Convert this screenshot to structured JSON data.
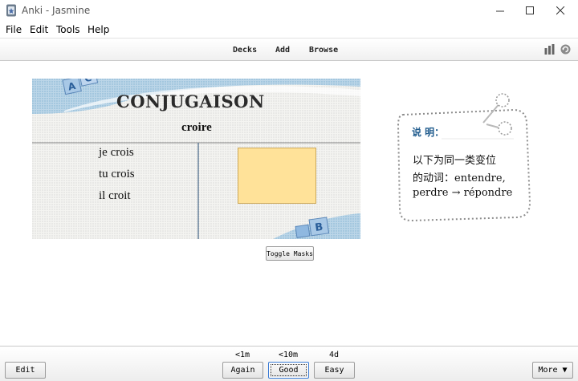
{
  "window": {
    "title": "Anki - Jasmine"
  },
  "menu": {
    "items": [
      "File",
      "Edit",
      "Tools",
      "Help"
    ]
  },
  "toolbar": {
    "decks": "Decks",
    "add": "Add",
    "browse": "Browse"
  },
  "card": {
    "heading": "CONJUGAISON",
    "verb": "croire",
    "conjugations": [
      "je crois",
      "tu crois",
      "il croit"
    ],
    "note_title": "说 明：",
    "note_lines": [
      "以下为同一类变位",
      "的动词：entendre,",
      "perdre → répondre"
    ],
    "mask_color": "#ffe299",
    "toggle_masks": "Toggle Masks"
  },
  "answer": {
    "edit": "Edit",
    "intervals": [
      "<1m",
      "<10m",
      "4d"
    ],
    "buttons": [
      "Again",
      "Good",
      "Easy"
    ],
    "more": "More ▼"
  }
}
